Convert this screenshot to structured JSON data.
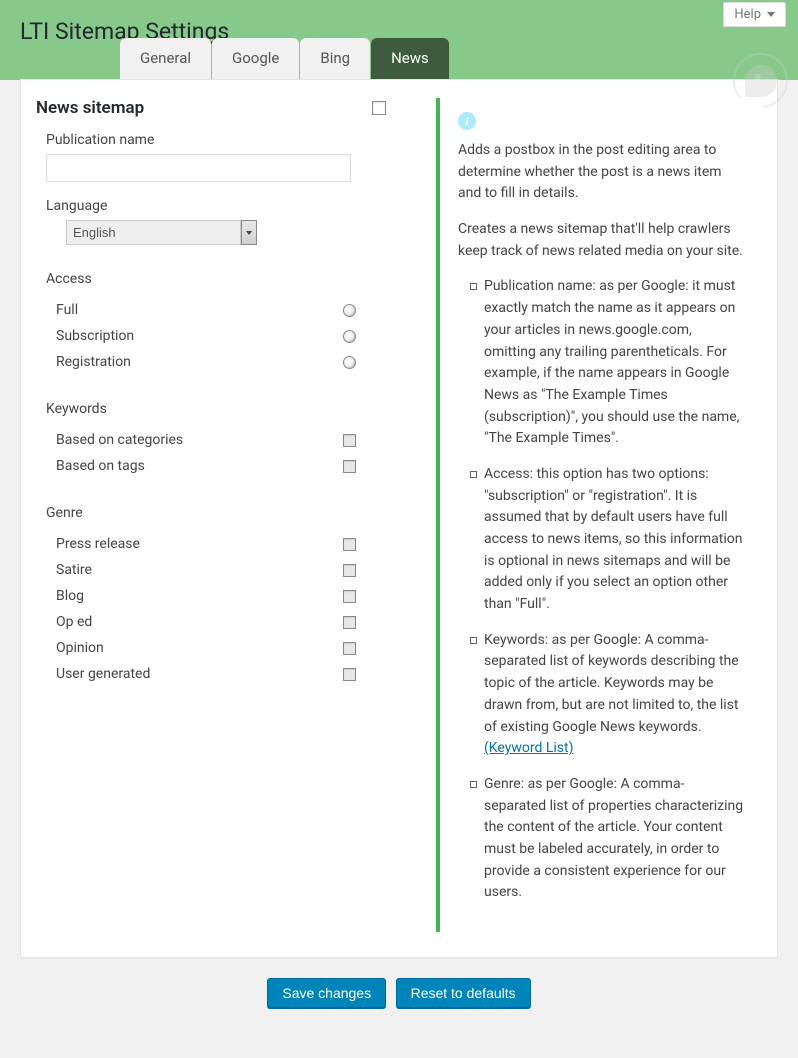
{
  "header": {
    "help_label": "Help",
    "page_title": "LTI Sitemap Settings"
  },
  "tabs": [
    {
      "label": "General",
      "active": false
    },
    {
      "label": "Google",
      "active": false
    },
    {
      "label": "Bing",
      "active": false
    },
    {
      "label": "News",
      "active": true
    }
  ],
  "left": {
    "section_title": "News sitemap",
    "publication_name_label": "Publication name",
    "publication_name_value": "",
    "language_label": "Language",
    "language_value": "English",
    "access_label": "Access",
    "access_options": [
      {
        "label": "Full"
      },
      {
        "label": "Subscription"
      },
      {
        "label": "Registration"
      }
    ],
    "keywords_label": "Keywords",
    "keywords_options": [
      {
        "label": "Based on categories"
      },
      {
        "label": "Based on tags"
      }
    ],
    "genre_label": "Genre",
    "genre_options": [
      {
        "label": "Press release"
      },
      {
        "label": "Satire"
      },
      {
        "label": "Blog"
      },
      {
        "label": "Op ed"
      },
      {
        "label": "Opinion"
      },
      {
        "label": "User generated"
      }
    ]
  },
  "help": {
    "para1": "Adds a postbox in the post editing area to determine whether the post is a news item and to fill in details.",
    "para2": "Creates a news sitemap that'll help crawlers keep track of news related media on your site.",
    "items": {
      "publication": "Publication name: as per Google: it must exactly match the name as it appears on your articles in news.google.com, omitting any trailing parentheticals. For example, if the name appears in Google News as \"The Example Times (subscription)\", you should use the name, \"The Example Times\".",
      "access": "Access: this option has two options: \"subscription\" or \"registration\". It is assumed that by default users have full access to news items, so this information is optional in news sitemaps and will be added only if you select an option other than \"Full\".",
      "keywords_prefix": "Keywords: as per Google: A comma-separated list of keywords describing the topic of the article. Keywords may be drawn from, but are not limited to, the list of existing Google News keywords. ",
      "keywords_link": "(Keyword List)",
      "genre": "Genre: as per Google: A comma-separated list of properties characterizing the content of the article. Your content must be labeled accurately, in order to provide a consistent experience for our users."
    }
  },
  "actions": {
    "save": "Save changes",
    "reset": "Reset to defaults"
  }
}
